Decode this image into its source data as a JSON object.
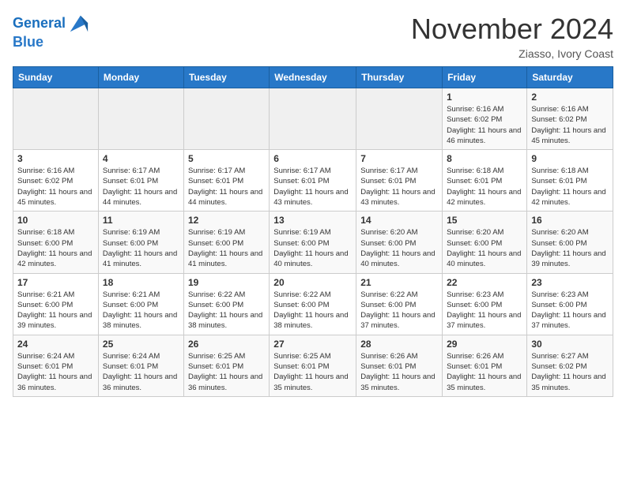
{
  "header": {
    "logo_line1": "General",
    "logo_line2": "Blue",
    "month_title": "November 2024",
    "location": "Ziasso, Ivory Coast"
  },
  "weekdays": [
    "Sunday",
    "Monday",
    "Tuesday",
    "Wednesday",
    "Thursday",
    "Friday",
    "Saturday"
  ],
  "weeks": [
    [
      {
        "day": "",
        "info": ""
      },
      {
        "day": "",
        "info": ""
      },
      {
        "day": "",
        "info": ""
      },
      {
        "day": "",
        "info": ""
      },
      {
        "day": "",
        "info": ""
      },
      {
        "day": "1",
        "info": "Sunrise: 6:16 AM\nSunset: 6:02 PM\nDaylight: 11 hours and 46 minutes."
      },
      {
        "day": "2",
        "info": "Sunrise: 6:16 AM\nSunset: 6:02 PM\nDaylight: 11 hours and 45 minutes."
      }
    ],
    [
      {
        "day": "3",
        "info": "Sunrise: 6:16 AM\nSunset: 6:02 PM\nDaylight: 11 hours and 45 minutes."
      },
      {
        "day": "4",
        "info": "Sunrise: 6:17 AM\nSunset: 6:01 PM\nDaylight: 11 hours and 44 minutes."
      },
      {
        "day": "5",
        "info": "Sunrise: 6:17 AM\nSunset: 6:01 PM\nDaylight: 11 hours and 44 minutes."
      },
      {
        "day": "6",
        "info": "Sunrise: 6:17 AM\nSunset: 6:01 PM\nDaylight: 11 hours and 43 minutes."
      },
      {
        "day": "7",
        "info": "Sunrise: 6:17 AM\nSunset: 6:01 PM\nDaylight: 11 hours and 43 minutes."
      },
      {
        "day": "8",
        "info": "Sunrise: 6:18 AM\nSunset: 6:01 PM\nDaylight: 11 hours and 42 minutes."
      },
      {
        "day": "9",
        "info": "Sunrise: 6:18 AM\nSunset: 6:01 PM\nDaylight: 11 hours and 42 minutes."
      }
    ],
    [
      {
        "day": "10",
        "info": "Sunrise: 6:18 AM\nSunset: 6:00 PM\nDaylight: 11 hours and 42 minutes."
      },
      {
        "day": "11",
        "info": "Sunrise: 6:19 AM\nSunset: 6:00 PM\nDaylight: 11 hours and 41 minutes."
      },
      {
        "day": "12",
        "info": "Sunrise: 6:19 AM\nSunset: 6:00 PM\nDaylight: 11 hours and 41 minutes."
      },
      {
        "day": "13",
        "info": "Sunrise: 6:19 AM\nSunset: 6:00 PM\nDaylight: 11 hours and 40 minutes."
      },
      {
        "day": "14",
        "info": "Sunrise: 6:20 AM\nSunset: 6:00 PM\nDaylight: 11 hours and 40 minutes."
      },
      {
        "day": "15",
        "info": "Sunrise: 6:20 AM\nSunset: 6:00 PM\nDaylight: 11 hours and 40 minutes."
      },
      {
        "day": "16",
        "info": "Sunrise: 6:20 AM\nSunset: 6:00 PM\nDaylight: 11 hours and 39 minutes."
      }
    ],
    [
      {
        "day": "17",
        "info": "Sunrise: 6:21 AM\nSunset: 6:00 PM\nDaylight: 11 hours and 39 minutes."
      },
      {
        "day": "18",
        "info": "Sunrise: 6:21 AM\nSunset: 6:00 PM\nDaylight: 11 hours and 38 minutes."
      },
      {
        "day": "19",
        "info": "Sunrise: 6:22 AM\nSunset: 6:00 PM\nDaylight: 11 hours and 38 minutes."
      },
      {
        "day": "20",
        "info": "Sunrise: 6:22 AM\nSunset: 6:00 PM\nDaylight: 11 hours and 38 minutes."
      },
      {
        "day": "21",
        "info": "Sunrise: 6:22 AM\nSunset: 6:00 PM\nDaylight: 11 hours and 37 minutes."
      },
      {
        "day": "22",
        "info": "Sunrise: 6:23 AM\nSunset: 6:00 PM\nDaylight: 11 hours and 37 minutes."
      },
      {
        "day": "23",
        "info": "Sunrise: 6:23 AM\nSunset: 6:00 PM\nDaylight: 11 hours and 37 minutes."
      }
    ],
    [
      {
        "day": "24",
        "info": "Sunrise: 6:24 AM\nSunset: 6:01 PM\nDaylight: 11 hours and 36 minutes."
      },
      {
        "day": "25",
        "info": "Sunrise: 6:24 AM\nSunset: 6:01 PM\nDaylight: 11 hours and 36 minutes."
      },
      {
        "day": "26",
        "info": "Sunrise: 6:25 AM\nSunset: 6:01 PM\nDaylight: 11 hours and 36 minutes."
      },
      {
        "day": "27",
        "info": "Sunrise: 6:25 AM\nSunset: 6:01 PM\nDaylight: 11 hours and 35 minutes."
      },
      {
        "day": "28",
        "info": "Sunrise: 6:26 AM\nSunset: 6:01 PM\nDaylight: 11 hours and 35 minutes."
      },
      {
        "day": "29",
        "info": "Sunrise: 6:26 AM\nSunset: 6:01 PM\nDaylight: 11 hours and 35 minutes."
      },
      {
        "day": "30",
        "info": "Sunrise: 6:27 AM\nSunset: 6:02 PM\nDaylight: 11 hours and 35 minutes."
      }
    ]
  ]
}
